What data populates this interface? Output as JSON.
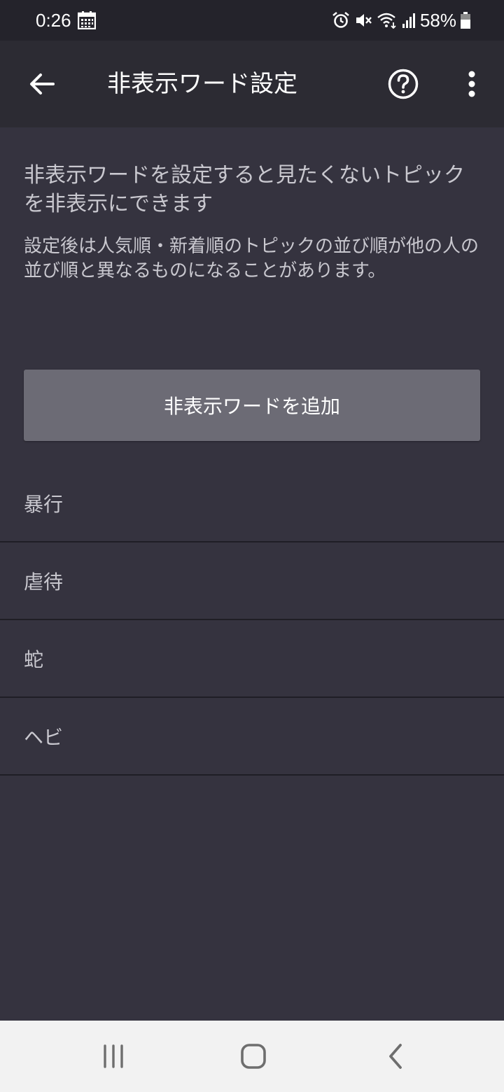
{
  "status_bar": {
    "time": "0:26",
    "battery": "58%"
  },
  "app_bar": {
    "title": "非表示ワード設定",
    "icons": [
      "arrow-back-icon",
      "help-circle-icon",
      "more-vert-icon"
    ]
  },
  "description": {
    "main": "非表示ワードを設定すると見たくないトピックを非表示にできます",
    "sub": "設定後は人気順・新着順のトピックの並び順が他の人の並び順と異なるものになることがあります。"
  },
  "add_button": {
    "label": "非表示ワードを追加"
  },
  "hidden_words": [
    "暴行",
    "虐待",
    "蛇",
    "ヘビ"
  ],
  "colors": {
    "background": "#35333f",
    "app_bar": "#2c2b33",
    "status_bar": "#24232b",
    "button": "#6c6b75",
    "text_secondary": "#c9c8cf",
    "nav_bar": "#f2f2f2"
  }
}
